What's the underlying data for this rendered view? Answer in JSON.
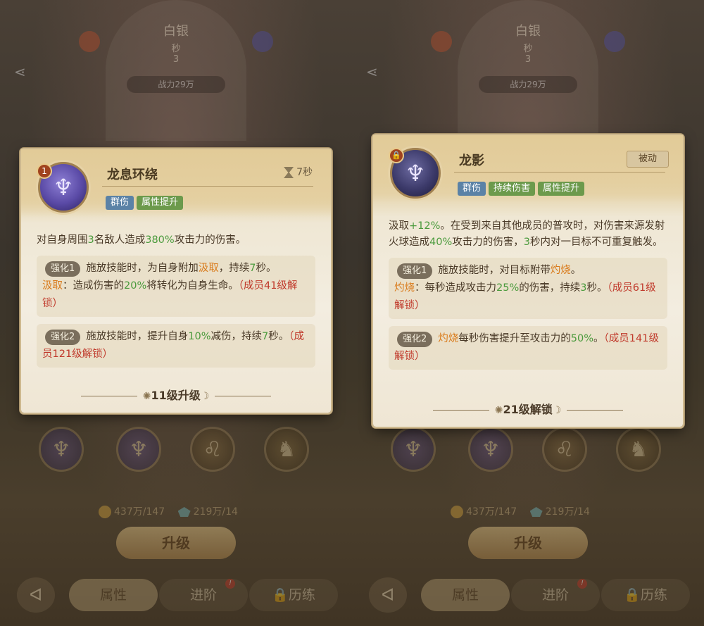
{
  "background": {
    "rank_title": "白银",
    "rank_sub": "秒",
    "rank_num": "3",
    "power_label": "战力29万",
    "resources": {
      "coin_text": "437万/147",
      "gem_text": "219万/14"
    },
    "upgrade_button": "升级",
    "tabs": [
      {
        "label": "属性"
      },
      {
        "label": "进阶"
      },
      {
        "label": "历练"
      }
    ],
    "tab_badge": "!"
  },
  "left_card": {
    "level_badge": "1",
    "name": "龙息环绕",
    "cooldown": "7秒",
    "tags": [
      "群伤",
      "属性提升"
    ],
    "description": [
      {
        "t": "对自身周围",
        "c": ""
      },
      {
        "t": "3",
        "c": "g"
      },
      {
        "t": "名敌人造成",
        "c": ""
      },
      {
        "t": "380%",
        "c": "g"
      },
      {
        "t": "攻击力的伤害。",
        "c": ""
      }
    ],
    "enhancements": [
      {
        "label": "强化1",
        "parts": [
          {
            "t": "施放技能时，为自身附加",
            "c": ""
          },
          {
            "t": "汲取",
            "c": "o"
          },
          {
            "t": "，持续",
            "c": ""
          },
          {
            "t": "7",
            "c": "g"
          },
          {
            "t": "秒。",
            "c": ""
          },
          {
            "t": "汲取",
            "c": "o",
            "br": true
          },
          {
            "t": "：造成伤害的",
            "c": ""
          },
          {
            "t": "20%",
            "c": "g"
          },
          {
            "t": "将转化为自身生命。",
            "c": ""
          },
          {
            "t": "（成员41级解锁）",
            "c": "red"
          }
        ]
      },
      {
        "label": "强化2",
        "parts": [
          {
            "t": "施放技能时，提升自身",
            "c": ""
          },
          {
            "t": "10%",
            "c": "g"
          },
          {
            "t": "减伤，持续",
            "c": ""
          },
          {
            "t": "7",
            "c": "g"
          },
          {
            "t": "秒。",
            "c": ""
          },
          {
            "t": "（成员121级解锁）",
            "c": "red"
          }
        ]
      }
    ],
    "footer": "11级升级"
  },
  "right_card": {
    "lock_icon": "lock-icon",
    "name": "龙影",
    "passive_label": "被动",
    "tags": [
      "群伤",
      "持续伤害",
      "属性提升"
    ],
    "description": [
      {
        "t": "汲取",
        "c": ""
      },
      {
        "t": "+12%",
        "c": "g"
      },
      {
        "t": "。在受到来自其他成员的普攻时，对伤害来源发射火球造成",
        "c": ""
      },
      {
        "t": "40%",
        "c": "g"
      },
      {
        "t": "攻击力的伤害，",
        "c": ""
      },
      {
        "t": "3",
        "c": "g"
      },
      {
        "t": "秒内对一目标不可重复触发。",
        "c": ""
      }
    ],
    "enhancements": [
      {
        "label": "强化1",
        "parts": [
          {
            "t": "施放技能时，对目标附带",
            "c": ""
          },
          {
            "t": "灼烧",
            "c": "o"
          },
          {
            "t": "。",
            "c": ""
          },
          {
            "t": "灼烧",
            "c": "o",
            "br": true
          },
          {
            "t": "：每秒造成攻击力",
            "c": ""
          },
          {
            "t": "25%",
            "c": "g"
          },
          {
            "t": "的伤害，持续",
            "c": ""
          },
          {
            "t": "3",
            "c": "g"
          },
          {
            "t": "秒。",
            "c": ""
          },
          {
            "t": "（成员61级解锁）",
            "c": "red"
          }
        ]
      },
      {
        "label": "强化2",
        "parts": [
          {
            "t": "灼烧",
            "c": "o"
          },
          {
            "t": "每秒伤害提升至攻击力的",
            "c": ""
          },
          {
            "t": "50%",
            "c": "g"
          },
          {
            "t": "。",
            "c": ""
          },
          {
            "t": "（成员141级解锁）",
            "c": "red"
          }
        ]
      }
    ],
    "footer": "21级解锁"
  },
  "colors": {
    "highlight_green": "#4a9a3c",
    "keyword_orange": "#d97a1a",
    "unlock_red": "#c0392b",
    "tag_blue": "#5b82a6",
    "tag_green": "#6c9a4c"
  }
}
